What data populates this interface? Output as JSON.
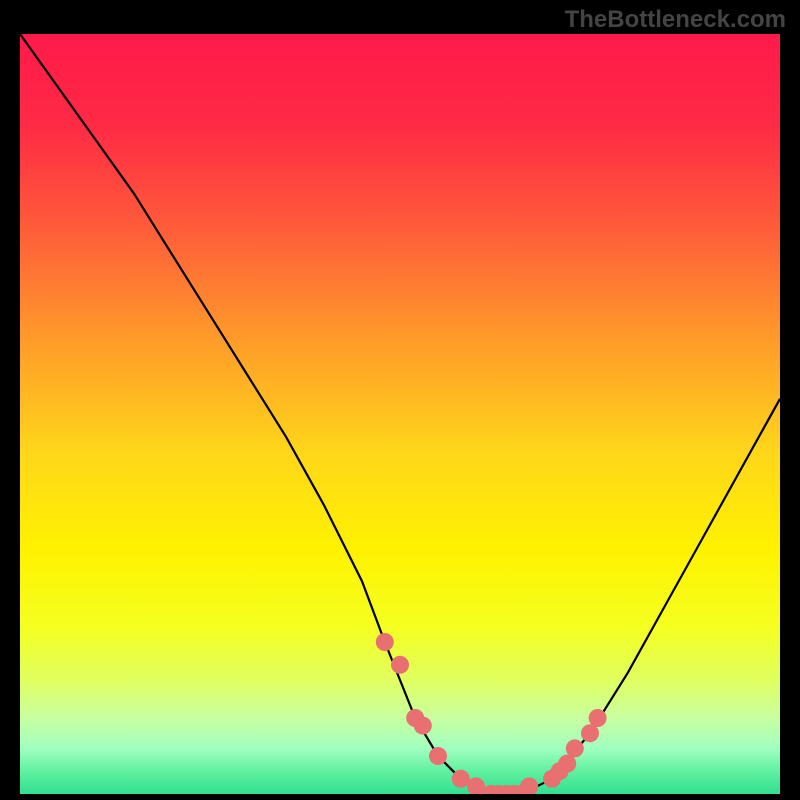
{
  "watermark": "TheBottleneck.com",
  "chart_data": {
    "type": "line",
    "title": "",
    "xlabel": "",
    "ylabel": "",
    "xlim": [
      0,
      100
    ],
    "ylim": [
      0,
      100
    ],
    "series": [
      {
        "name": "bottleneck-curve",
        "x": [
          0,
          5,
          10,
          15,
          20,
          25,
          30,
          35,
          40,
          45,
          48,
          52,
          55,
          58,
          62,
          66,
          70,
          75,
          80,
          85,
          90,
          95,
          100
        ],
        "y": [
          100,
          93,
          86,
          79,
          71,
          63,
          55,
          47,
          38,
          28,
          20,
          10,
          5,
          2,
          0,
          0,
          2,
          8,
          16,
          25,
          34,
          43,
          52
        ]
      }
    ],
    "markers": {
      "name": "highlight-dots",
      "x": [
        48,
        50,
        52,
        53,
        55,
        58,
        60,
        62,
        63,
        64,
        65,
        66,
        67,
        70,
        71,
        72,
        73,
        75,
        76
      ],
      "y": [
        20,
        17,
        10,
        9,
        5,
        2,
        1,
        0,
        0,
        0,
        0,
        0,
        1,
        2,
        3,
        4,
        6,
        8,
        10
      ]
    },
    "gradient_stops": [
      {
        "pos": 0.0,
        "color": "#ff1a4a"
      },
      {
        "pos": 0.12,
        "color": "#ff2a45"
      },
      {
        "pos": 0.25,
        "color": "#ff5a3a"
      },
      {
        "pos": 0.4,
        "color": "#ff9a2a"
      },
      {
        "pos": 0.55,
        "color": "#ffd61a"
      },
      {
        "pos": 0.68,
        "color": "#fff200"
      },
      {
        "pos": 0.78,
        "color": "#f5ff20"
      },
      {
        "pos": 0.85,
        "color": "#e0ff60"
      },
      {
        "pos": 0.9,
        "color": "#c8ffa0"
      },
      {
        "pos": 0.94,
        "color": "#a0ffc0"
      },
      {
        "pos": 0.97,
        "color": "#60f0a0"
      },
      {
        "pos": 1.0,
        "color": "#30e090"
      }
    ]
  }
}
